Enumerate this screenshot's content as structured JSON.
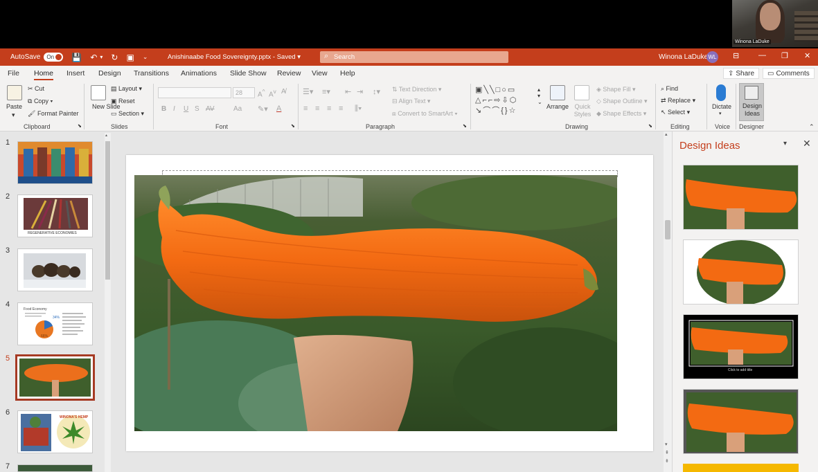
{
  "video": {
    "participant_name": "Winona LaDuke"
  },
  "titlebar": {
    "autosave_label": "AutoSave",
    "autosave_state": "On",
    "document_title": "Anishinaabe Food Sovereignty.pptx - Saved",
    "search_placeholder": "Search",
    "user_name": "Winona LaDuke",
    "user_initials": "WL"
  },
  "menu": {
    "tabs": [
      "File",
      "Home",
      "Insert",
      "Design",
      "Transitions",
      "Animations",
      "Slide Show",
      "Review",
      "View",
      "Help"
    ],
    "active": "Home",
    "share_label": "Share",
    "comments_label": "Comments"
  },
  "ribbon": {
    "clipboard": {
      "paste": "Paste",
      "cut": "Cut",
      "copy": "Copy",
      "format_painter": "Format Painter",
      "label": "Clipboard"
    },
    "slides": {
      "new_slide": "New Slide",
      "layout": "Layout",
      "reset": "Reset",
      "section": "Section",
      "label": "Slides"
    },
    "font": {
      "size": "28",
      "label": "Font",
      "buttons": [
        "B",
        "I",
        "U",
        "S",
        "AV",
        "Aa"
      ]
    },
    "paragraph": {
      "text_direction": "Text Direction",
      "align_text": "Align Text",
      "convert_smartart": "Convert to SmartArt",
      "label": "Paragraph"
    },
    "drawing": {
      "arrange": "Arrange",
      "quick_styles": "Quick Styles",
      "shape_fill": "Shape Fill",
      "shape_outline": "Shape Outline",
      "shape_effects": "Shape Effects",
      "label": "Drawing"
    },
    "editing": {
      "find": "Find",
      "replace": "Replace",
      "select": "Select",
      "label": "Editing"
    },
    "voice": {
      "dictate": "Dictate",
      "label": "Voice"
    },
    "designer": {
      "design_ideas": "Design Ideas",
      "label": "Designer"
    }
  },
  "thumbnails": {
    "numbers": [
      "1",
      "2",
      "3",
      "4",
      "5",
      "6",
      "7"
    ],
    "active_index": 5,
    "slide2_caption": "REGENERATIVE ECONOMIES",
    "slide4_title": "Food Economy",
    "slide4_pct_a": "34%",
    "slide4_pct_b": "66%",
    "slide6_text": "WINONA'S HEMP"
  },
  "designer": {
    "title": "Design Ideas",
    "card3_caption": "Click to add title"
  }
}
